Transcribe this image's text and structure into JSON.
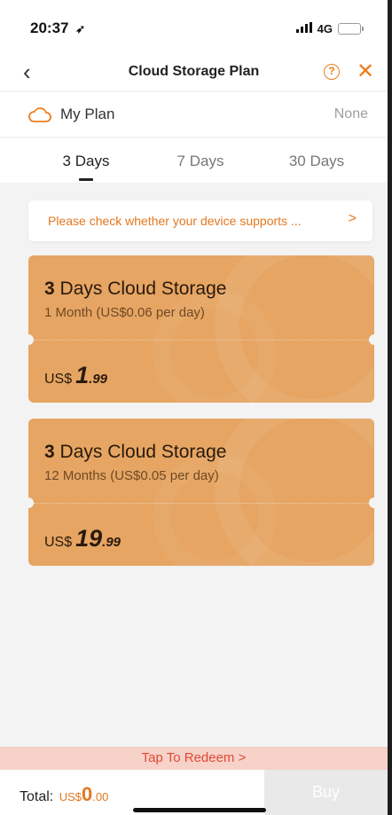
{
  "status_bar": {
    "time": "20:37",
    "location_icon": "location-arrow-icon",
    "network": "4G",
    "signal_icon": "signal-bars-icon",
    "battery_icon": "battery-icon",
    "battery_level": 0.35,
    "battery_color": "#f2c318"
  },
  "nav": {
    "back_icon": "chevron-left-icon",
    "title": "Cloud Storage Plan",
    "help_icon": "question-circle-icon",
    "close_icon": "close-icon",
    "accent_color": "#ee7c1c"
  },
  "my_plan": {
    "icon": "cloud-icon",
    "label": "My Plan",
    "value": "None"
  },
  "tabs": [
    {
      "label": "3 Days",
      "active": true
    },
    {
      "label": "7 Days",
      "active": false
    },
    {
      "label": "30 Days",
      "active": false
    }
  ],
  "notice": {
    "text": "Please check whether your device supports ...",
    "arrow": ">"
  },
  "plans": [
    {
      "title_num": "3",
      "title_rest": "Days Cloud Storage",
      "subtitle": "1 Month (US$0.06 per day)",
      "currency": "US$",
      "price_int": "1",
      "price_dec": ".99"
    },
    {
      "title_num": "3",
      "title_rest": "Days Cloud Storage",
      "subtitle": "12 Months (US$0.05 per day)",
      "currency": "US$",
      "price_int": "19",
      "price_dec": ".99"
    }
  ],
  "redeem": {
    "label": "Tap To Redeem >"
  },
  "footer": {
    "total_label": "Total:",
    "currency": "US$",
    "total_int": "0",
    "total_dec": ".00",
    "buy_label": "Buy"
  },
  "colors": {
    "card_bg": "#e6a563",
    "accent": "#e4771f",
    "redeem_bg": "#f6d2c9",
    "redeem_text": "#e24a35"
  }
}
